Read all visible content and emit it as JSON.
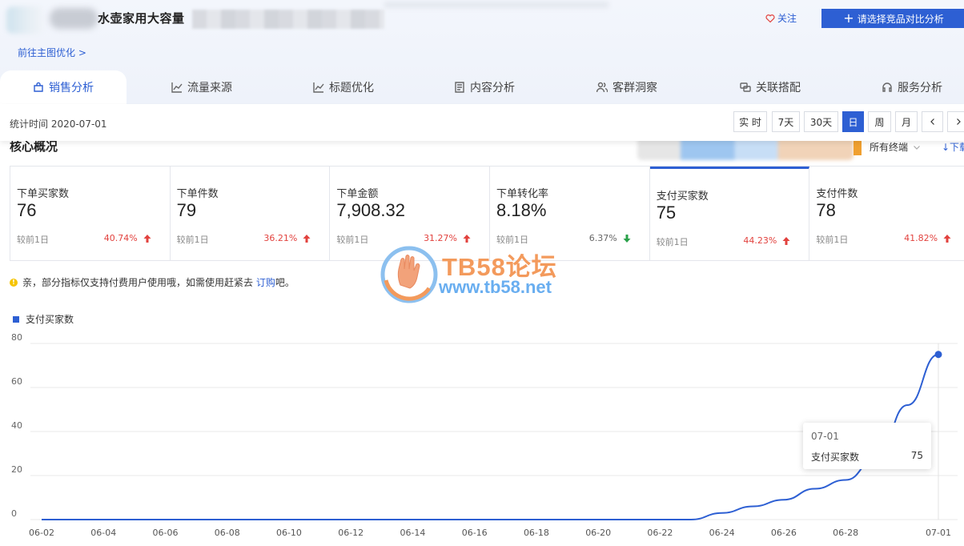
{
  "header": {
    "product_title": "水壶家用大容量",
    "back_link": "前往主图优化 >",
    "follow_label": "关注",
    "compare_button": "请选择竞品对比分析"
  },
  "tabs": [
    {
      "label": "销售分析",
      "icon": "bag-icon",
      "active": true
    },
    {
      "label": "流量来源",
      "icon": "trend-icon"
    },
    {
      "label": "标题优化",
      "icon": "trend-icon"
    },
    {
      "label": "内容分析",
      "icon": "document-icon"
    },
    {
      "label": "客群洞察",
      "icon": "users-icon"
    },
    {
      "label": "关联搭配",
      "icon": "link-icon"
    },
    {
      "label": "服务分析",
      "icon": "headset-icon"
    }
  ],
  "toolbar": {
    "stat_time": "统计时间 2020-07-01",
    "periods": [
      "实 时",
      "7天",
      "30天",
      "日",
      "周",
      "月"
    ],
    "active_period": "日",
    "prev_icon": "chevron-left-icon",
    "next_icon": "chevron-right-icon"
  },
  "section": {
    "title": "核心概况",
    "terminal": "所有终端",
    "download": "↓下载"
  },
  "cards": [
    {
      "label": "下单买家数",
      "value": "76",
      "compare": "较前1日",
      "pct": "40.74%",
      "direction": "up"
    },
    {
      "label": "下单件数",
      "value": "79",
      "compare": "较前1日",
      "pct": "36.21%",
      "direction": "up"
    },
    {
      "label": "下单金额",
      "value": "7,908.32",
      "compare": "较前1日",
      "pct": "31.27%",
      "direction": "up"
    },
    {
      "label": "下单转化率",
      "value": "8.18%",
      "compare": "较前1日",
      "pct": "6.37%",
      "direction": "down"
    },
    {
      "label": "支付买家数",
      "value": "75",
      "compare": "较前1日",
      "pct": "44.23%",
      "direction": "up",
      "active": true
    },
    {
      "label": "支付件数",
      "value": "78",
      "compare": "较前1日",
      "pct": "41.82%",
      "direction": "up"
    }
  ],
  "notice": {
    "text_before": "亲，部分指标仅支持付费用户使用哦，如需使用赶紧去 ",
    "link": "订购",
    "text_after": "吧。"
  },
  "watermark": {
    "text": "TB58论坛",
    "url": "www.tb58.net"
  },
  "colors": {
    "accent": "#2d5fd3",
    "up": "#e2423e",
    "down": "#2aa14a"
  },
  "tooltip": {
    "date": "07-01",
    "series": "支付买家数",
    "value": "75"
  },
  "chart_data": {
    "type": "line",
    "legend": [
      "支付买家数"
    ],
    "x": [
      "06-02",
      "06-03",
      "06-04",
      "06-05",
      "06-06",
      "06-07",
      "06-08",
      "06-09",
      "06-10",
      "06-11",
      "06-12",
      "06-13",
      "06-14",
      "06-15",
      "06-16",
      "06-17",
      "06-18",
      "06-19",
      "06-20",
      "06-21",
      "06-22",
      "06-23",
      "06-24",
      "06-25",
      "06-26",
      "06-27",
      "06-28",
      "06-29",
      "06-30",
      "07-01"
    ],
    "x_tick_labels": [
      "06-02",
      "06-04",
      "06-06",
      "06-08",
      "06-10",
      "06-12",
      "06-14",
      "06-16",
      "06-18",
      "06-20",
      "06-22",
      "06-24",
      "06-26",
      "06-28",
      "07-01"
    ],
    "series": [
      {
        "name": "支付买家数",
        "values": [
          0,
          0,
          0,
          0,
          0,
          0,
          0,
          0,
          0,
          0,
          0,
          0,
          0,
          0,
          0,
          0,
          0,
          0,
          0,
          0,
          0,
          0,
          3,
          6,
          9,
          14,
          18,
          28,
          52,
          75
        ]
      }
    ],
    "y_ticks": [
      0,
      20,
      40,
      60,
      80
    ],
    "ylim": [
      0,
      80
    ],
    "grid": true
  }
}
